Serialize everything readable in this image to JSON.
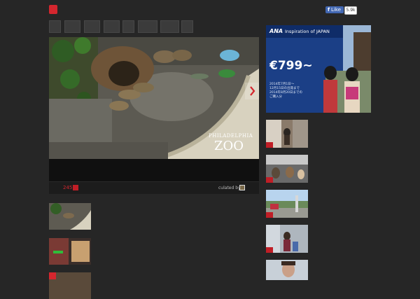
{
  "header": {
    "logo_mark": "",
    "logo_word": "",
    "tagline": "",
    "facebook": {
      "button_label": "Like",
      "count": "5.9k"
    }
  },
  "nav": {
    "items": [
      {
        "label": ""
      },
      {
        "label": ""
      },
      {
        "label": ""
      },
      {
        "label": ""
      },
      {
        "label": ""
      },
      {
        "label": ""
      },
      {
        "label": ""
      },
      {
        "label": ""
      }
    ]
  },
  "hero": {
    "image_caption_line1": "PHILADELPHIA",
    "image_caption_line2": "ZOO",
    "title": "",
    "count": "245",
    "curated_label": "culated by"
  },
  "list": {
    "items": [
      {
        "title": ""
      },
      {
        "title": ""
      },
      {
        "title": ""
      }
    ]
  },
  "sidebar": {
    "heading": "",
    "ad": {
      "brand": "ANA",
      "brand_tagline": "Inspiration of JAPAN",
      "headline_line1": "",
      "headline_line2": "",
      "price": "€799~",
      "subtitle": "",
      "dates_line1": "2014年7月1日～",
      "dates_line2": "12月15日の出発まで",
      "dates_line3": "2014年8月20日までの",
      "dates_line4": "ご購入分"
    },
    "items": [
      {
        "title": ""
      },
      {
        "title": ""
      },
      {
        "title": ""
      },
      {
        "title": ""
      },
      {
        "title": ""
      }
    ]
  },
  "colors": {
    "background": "#262626",
    "brand_red": "#d4262e",
    "facebook_blue": "#4267b2",
    "ad_blue": "#1b3f86"
  }
}
